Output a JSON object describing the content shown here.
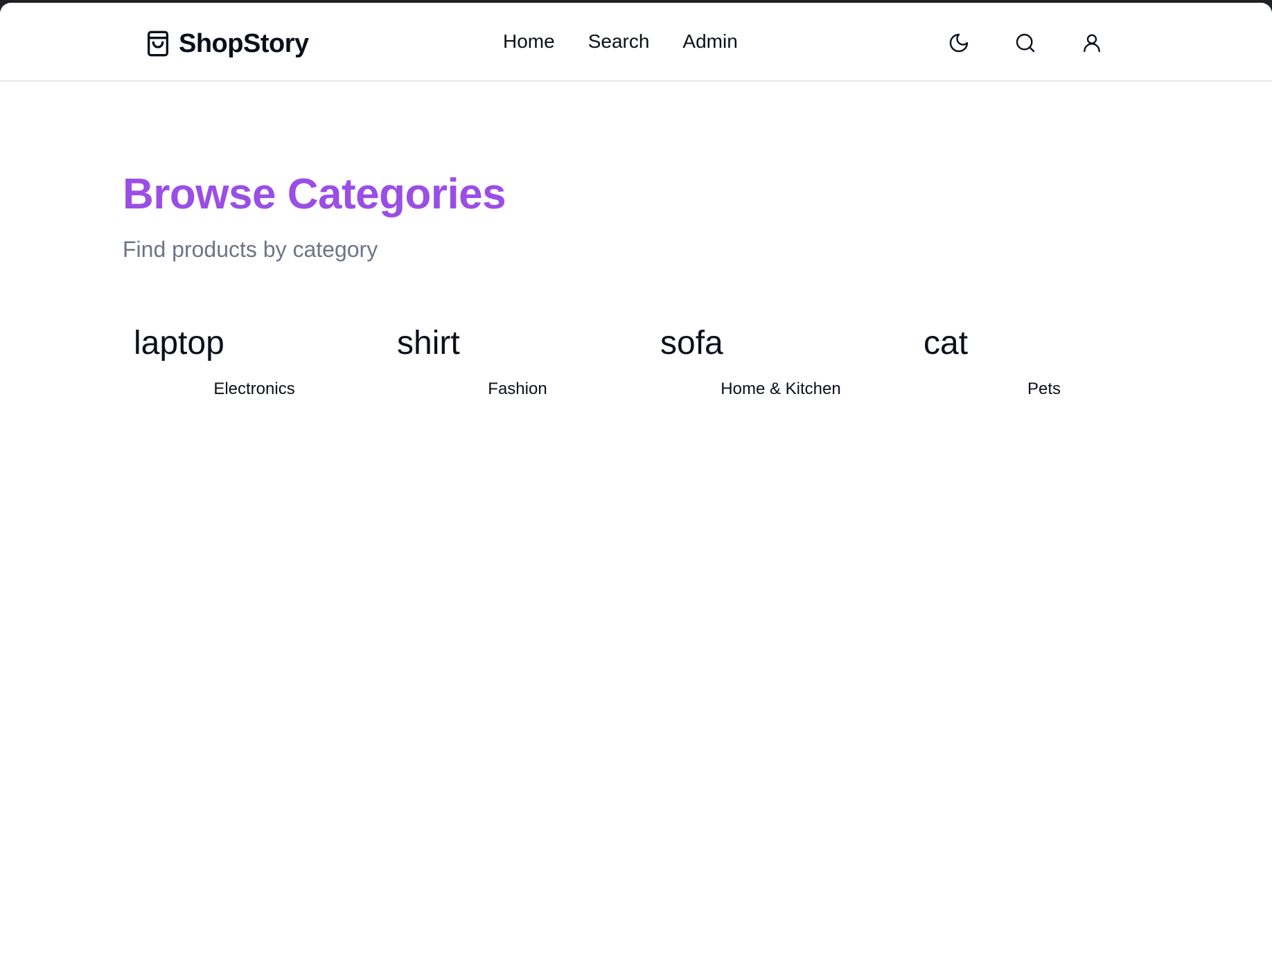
{
  "navbar": {
    "brand": "ShopStory",
    "links": [
      {
        "label": "Home"
      },
      {
        "label": "Search"
      },
      {
        "label": "Admin"
      }
    ],
    "actions": [
      "moon-icon",
      "search-icon",
      "user-icon"
    ]
  },
  "main": {
    "title": "Browse Categories",
    "subtitle": "Find products by category",
    "title_color": "#9a4ee6",
    "categories": [
      {
        "image_alt": "laptop",
        "name": "Electronics"
      },
      {
        "image_alt": "shirt",
        "name": "Fashion"
      },
      {
        "image_alt": "sofa",
        "name": "Home & Kitchen"
      },
      {
        "image_alt": "cat",
        "name": "Pets"
      }
    ]
  }
}
